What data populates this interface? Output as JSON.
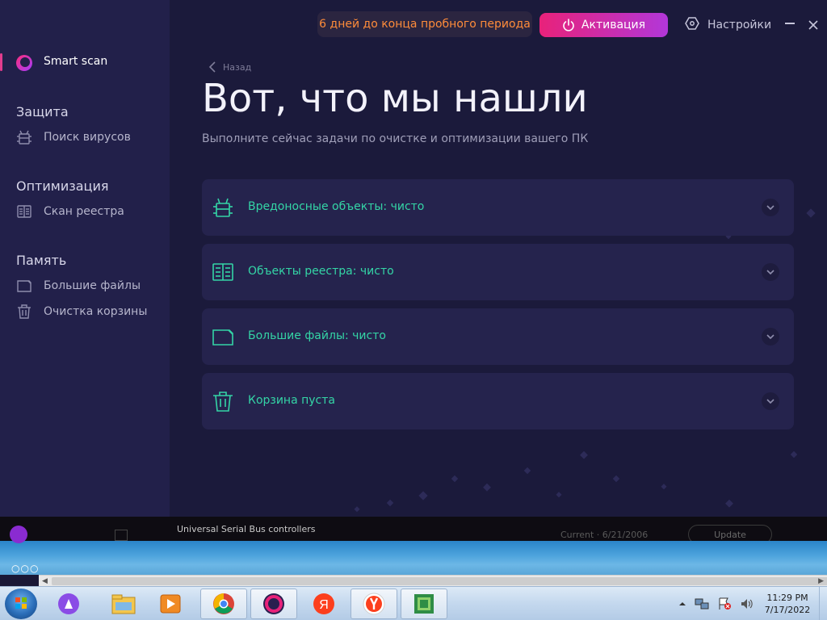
{
  "app": {
    "trial_text": "6 дней до конца пробного периода",
    "activate_label": "Активация",
    "settings_label": "Настройки",
    "back_label": "Назад",
    "title": "Вот, что мы нашли",
    "subtitle": "Выполните сейчас задачи по очистке и оптимизации вашего ПК",
    "accent_color": "#e8227a",
    "ok_color": "#34d5a6"
  },
  "sidebar": {
    "smart_scan": "Smart scan",
    "sections": [
      {
        "title": "Защита",
        "items": [
          {
            "label": "Поиск вирусов",
            "icon": "bug-icon"
          }
        ]
      },
      {
        "title": "Оптимизация",
        "items": [
          {
            "label": "Скан реестра",
            "icon": "book-icon"
          }
        ]
      },
      {
        "title": "Память",
        "items": [
          {
            "label": "Большие файлы",
            "icon": "folder-icon"
          },
          {
            "label": "Очистка корзины",
            "icon": "trash-icon"
          }
        ]
      }
    ]
  },
  "results": [
    {
      "label": "Вредоносные объекты: чисто",
      "icon": "bug-icon"
    },
    {
      "label": "Объекты реестра: чисто",
      "icon": "book-icon"
    },
    {
      "label": "Большие файлы: чисто",
      "icon": "folder-icon"
    },
    {
      "label": "Корзина пуста",
      "icon": "trash-icon"
    }
  ],
  "background": {
    "device_text": "Universal Serial Bus controllers",
    "current_text": "Current · 6/21/2006",
    "update_label": "Update"
  },
  "taskbar": {
    "apps": [
      "alice-icon",
      "file-explorer-icon",
      "media-player-icon",
      "chrome-icon",
      "app-logo-icon",
      "yandex-browser-icon",
      "yandex-icon",
      "image-viewer-icon"
    ],
    "time": "11:29 PM",
    "date": "7/17/2022"
  }
}
